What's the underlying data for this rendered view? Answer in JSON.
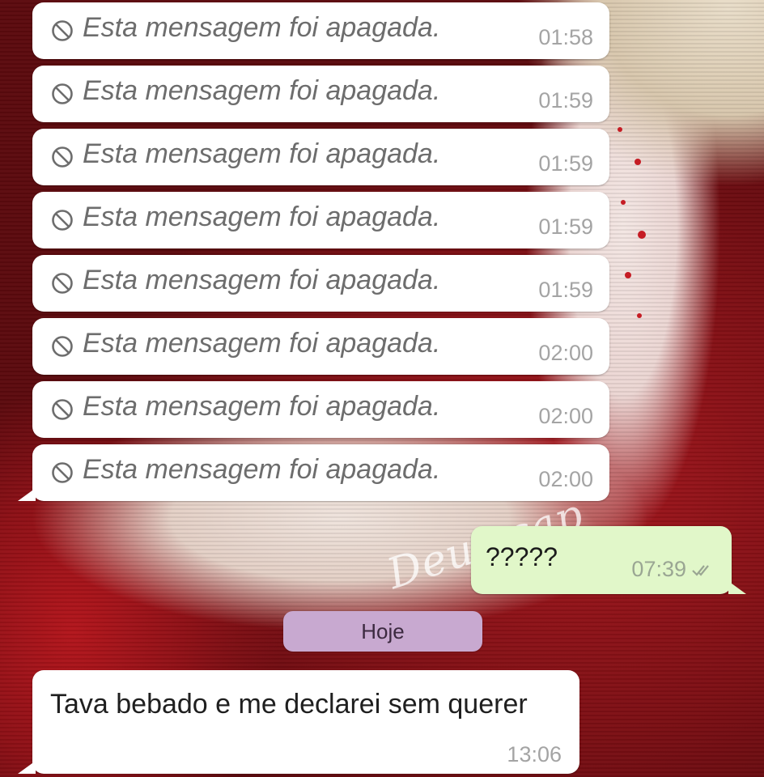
{
  "chat": {
    "deleted_messages": [
      {
        "text": "Esta mensagem foi apagada.",
        "time": "01:58"
      },
      {
        "text": "Esta mensagem foi apagada.",
        "time": "01:59"
      },
      {
        "text": "Esta mensagem foi apagada.",
        "time": "01:59"
      },
      {
        "text": "Esta mensagem foi apagada.",
        "time": "01:59"
      },
      {
        "text": "Esta mensagem foi apagada.",
        "time": "01:59"
      },
      {
        "text": "Esta mensagem foi apagada.",
        "time": "02:00"
      },
      {
        "text": "Esta mensagem foi apagada.",
        "time": "02:00"
      },
      {
        "text": "Esta mensagem foi apagada.",
        "time": "02:00"
      }
    ],
    "outgoing_message": {
      "text": "?????",
      "time": "07:39",
      "status_icon": "double-check-icon"
    },
    "date_separator": "Hoje",
    "incoming_message": {
      "text": "Tava bebado e me declarei sem querer",
      "time": "13:06"
    },
    "watermark": "Deus cap"
  },
  "icons": {
    "deleted": "blocked-circle-icon",
    "read_receipt": "double-check-icon"
  },
  "colors": {
    "incoming_bubble": "#ffffff",
    "outgoing_bubble": "#e1f7c9",
    "date_pill": "#c8a9d0",
    "deleted_text": "#6d6d6d",
    "timestamp": "#a4a4a4"
  }
}
